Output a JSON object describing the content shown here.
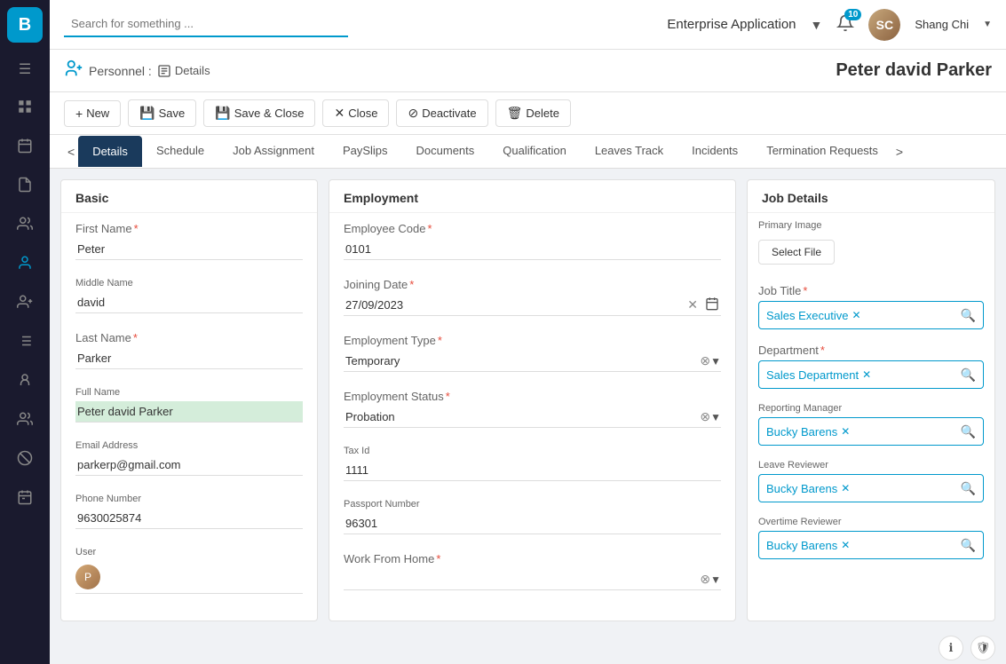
{
  "sidebar": {
    "logo": "B",
    "items": [
      {
        "name": "dashboard-icon",
        "icon": "⊞",
        "active": false
      },
      {
        "name": "calendar-icon",
        "icon": "📅",
        "active": false
      },
      {
        "name": "document-icon",
        "icon": "📄",
        "active": false
      },
      {
        "name": "team-icon",
        "icon": "👥",
        "active": false
      },
      {
        "name": "person-icon",
        "icon": "👤",
        "active": false
      },
      {
        "name": "users-manage-icon",
        "icon": "👫",
        "active": false
      },
      {
        "name": "list-icon",
        "icon": "≡",
        "active": false
      },
      {
        "name": "profile-icon",
        "icon": "🧍",
        "active": false
      },
      {
        "name": "people-settings-icon",
        "icon": "🧑‍🤝‍🧑",
        "active": false
      },
      {
        "name": "cancel-icon",
        "icon": "✕",
        "active": false
      },
      {
        "name": "schedule-icon",
        "icon": "📆",
        "active": false
      }
    ]
  },
  "header": {
    "search_placeholder": "Search for something ...",
    "app_name": "Enterprise Application",
    "notification_count": "10",
    "user_name": "Shang Chi"
  },
  "breadcrumb": {
    "section": "Personnel :",
    "page": "Details"
  },
  "page_title": "Peter david Parker",
  "toolbar": {
    "new_label": "New",
    "save_label": "Save",
    "save_close_label": "Save & Close",
    "close_label": "Close",
    "deactivate_label": "Deactivate",
    "delete_label": "Delete"
  },
  "tabs": {
    "prev_label": "<",
    "next_label": ">",
    "items": [
      {
        "label": "Details",
        "active": true
      },
      {
        "label": "Schedule",
        "active": false
      },
      {
        "label": "Job Assignment",
        "active": false
      },
      {
        "label": "PaySlips",
        "active": false
      },
      {
        "label": "Documents",
        "active": false
      },
      {
        "label": "Qualification",
        "active": false
      },
      {
        "label": "Leaves Track",
        "active": false
      },
      {
        "label": "Incidents",
        "active": false
      },
      {
        "label": "Termination Requests",
        "active": false
      }
    ]
  },
  "basic": {
    "title": "Basic",
    "first_name_label": "First Name",
    "first_name_value": "Peter",
    "middle_name_label": "Middle Name",
    "middle_name_value": "david",
    "last_name_label": "Last Name",
    "last_name_value": "Parker",
    "full_name_label": "Full Name",
    "full_name_value": "Peter david Parker",
    "email_label": "Email Address",
    "email_value": "parkerp@gmail.com",
    "phone_label": "Phone Number",
    "phone_value": "9630025874",
    "user_label": "User"
  },
  "employment": {
    "title": "Employment",
    "emp_code_label": "Employee Code",
    "emp_code_value": "0101",
    "joining_date_label": "Joining Date",
    "joining_date_value": "27/09/2023",
    "emp_type_label": "Employment Type",
    "emp_type_value": "Temporary",
    "emp_status_label": "Employment Status",
    "emp_status_value": "Probation",
    "tax_id_label": "Tax Id",
    "tax_id_value": "1111",
    "passport_label": "Passport Number",
    "passport_value": "96301",
    "wfh_label": "Work From Home"
  },
  "job_details": {
    "title": "Job Details",
    "primary_image_label": "Primary Image",
    "select_file_label": "Select File",
    "job_title_label": "Job Title",
    "job_title_value": "Sales Executive",
    "department_label": "Department",
    "department_value": "Sales Department",
    "reporting_manager_label": "Reporting Manager",
    "reporting_manager_value": "Bucky Barens",
    "leave_reviewer_label": "Leave Reviewer",
    "leave_reviewer_value": "Bucky Barens",
    "overtime_reviewer_label": "Overtime Reviewer",
    "overtime_reviewer_value": "Bucky Barens"
  },
  "colors": {
    "accent": "#0099cc",
    "nav_bg": "#1a1a2e",
    "active_tab_bg": "#1a3a5c",
    "tag_color": "#0099cc",
    "full_name_bg": "#e8f4e8"
  }
}
